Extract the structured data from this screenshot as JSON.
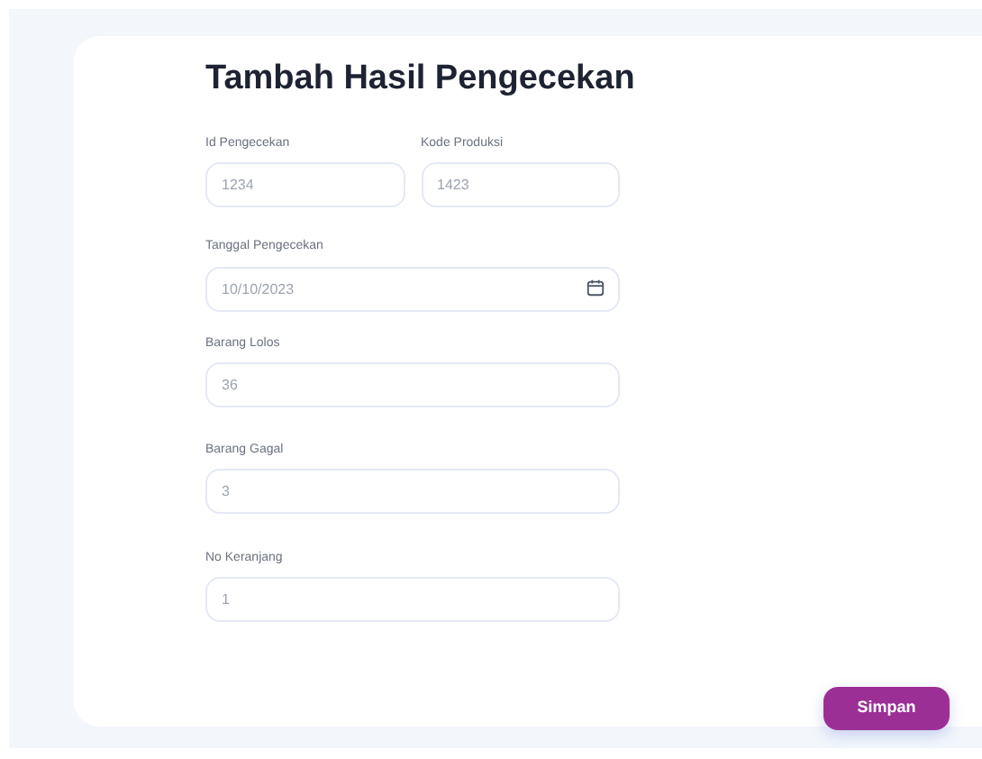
{
  "title": "Tambah Hasil Pengecekan",
  "fields": [
    {
      "label": "Id Pengecekan",
      "placeholder": "1234",
      "kind": "half"
    },
    {
      "label": "Kode Produksi",
      "placeholder": "1423",
      "kind": "half"
    },
    {
      "label": "Tanggal Pengecekan",
      "placeholder": "10/10/2023",
      "kind": "date"
    },
    {
      "label": "Barang Lolos",
      "placeholder": "36",
      "kind": "text"
    },
    {
      "label": "Barang Gagal",
      "placeholder": "3",
      "kind": "text"
    },
    {
      "label": "No Keranjang",
      "placeholder": "1",
      "kind": "text"
    }
  ],
  "submit": "Simpan"
}
